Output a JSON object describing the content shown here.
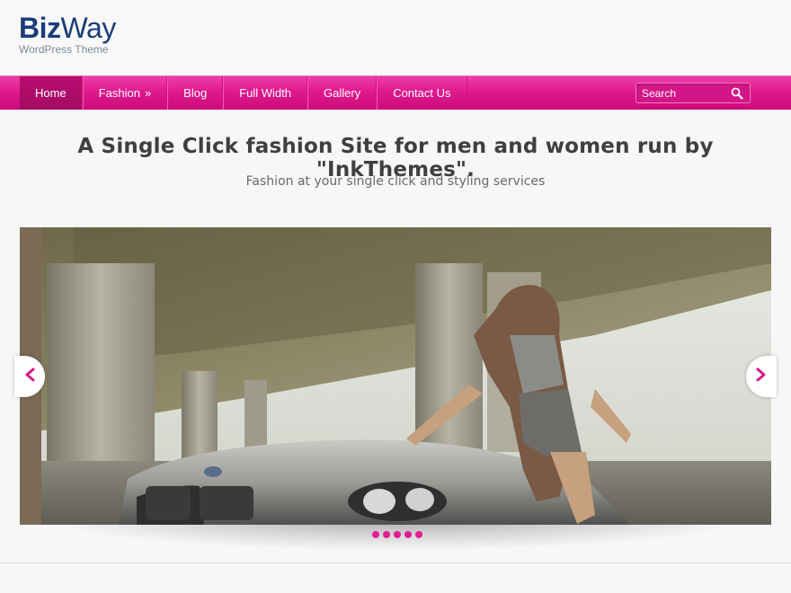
{
  "logo": {
    "part1": "Biz",
    "part2": "Way",
    "tagline": "WordPress Theme",
    "color": "#1a3c78"
  },
  "nav": {
    "items": [
      {
        "label": "Home",
        "active": true
      },
      {
        "label": "Fashion",
        "has_submenu": true,
        "submenu_glyph": "»"
      },
      {
        "label": "Blog"
      },
      {
        "label": "Full Width"
      },
      {
        "label": "Gallery"
      },
      {
        "label": "Contact Us"
      }
    ],
    "accent_color": "#e01a8d"
  },
  "search": {
    "placeholder": "Search",
    "icon": "search-icon"
  },
  "hero": {
    "headline": "A Single Click fashion Site for men and women run by \"InkThemes\".",
    "subheadline": "Fashion at your single click and styling services"
  },
  "slider": {
    "prev_icon": "chevron-left-icon",
    "next_icon": "chevron-right-icon",
    "slide_count": 5,
    "active_slide": 1,
    "dot_color": "#e31d93"
  }
}
